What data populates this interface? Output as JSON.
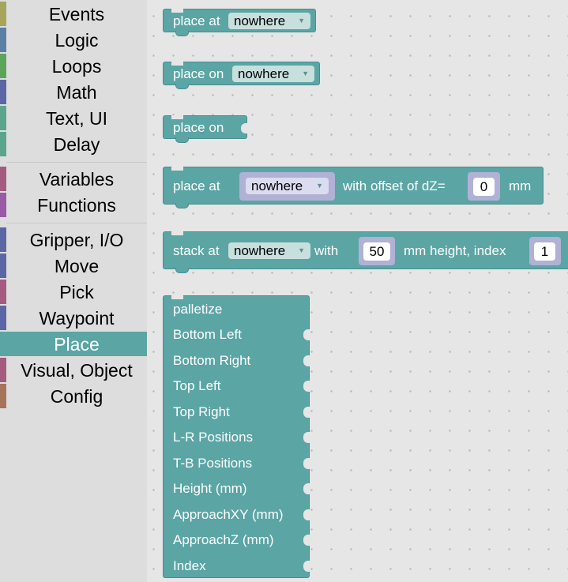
{
  "toolbox": {
    "categories": [
      {
        "label": "Events",
        "color": "#a5a55b"
      },
      {
        "label": "Logic",
        "color": "#5b80a5"
      },
      {
        "label": "Loops",
        "color": "#5ba55b"
      },
      {
        "label": "Math",
        "color": "#5b67a5"
      },
      {
        "label": "Text, UI",
        "color": "#5ba58c"
      },
      {
        "label": "Delay",
        "color": "#5ba58c"
      },
      {
        "label": "Variables",
        "color": "#a55b80"
      },
      {
        "label": "Functions",
        "color": "#995ba5"
      },
      {
        "label": "Gripper, I/O",
        "color": "#5b67a5"
      },
      {
        "label": "Move",
        "color": "#5b67a5"
      },
      {
        "label": "Pick",
        "color": "#a55b80"
      },
      {
        "label": "Waypoint",
        "color": "#5b67a5"
      },
      {
        "label": "Place",
        "color": "#5ba5a5",
        "selected": true
      },
      {
        "label": "Visual, Object",
        "color": "#a55b80"
      },
      {
        "label": "Config",
        "color": "#a5745b"
      }
    ]
  },
  "blocks": {
    "place_at": {
      "label": "place at",
      "dropdown": "nowhere"
    },
    "place_on_dd": {
      "label": "place on",
      "dropdown": "nowhere"
    },
    "place_on": {
      "label": "place on"
    },
    "place_at_offset": {
      "label": "place at",
      "dropdown": "nowhere",
      "offset_label": "with offset of dZ=",
      "offset_value": "0",
      "unit": "mm"
    },
    "stack_at": {
      "label": "stack at",
      "dropdown": "nowhere",
      "with_label": "with",
      "height_value": "50",
      "height_label": "mm height, index",
      "index_value": "1"
    },
    "palletize": {
      "title": "palletize",
      "inputs": [
        "Bottom Left",
        "Bottom Right",
        "Top Left",
        "Top Right",
        "L-R Positions",
        "T-B Positions",
        "Height (mm)",
        "ApproachXY (mm)",
        "ApproachZ (mm)",
        "Index"
      ]
    }
  },
  "colors": {
    "block": "#5ba5a5",
    "dropdown": "#c7e0dd",
    "slot": "#b1b1d6"
  }
}
